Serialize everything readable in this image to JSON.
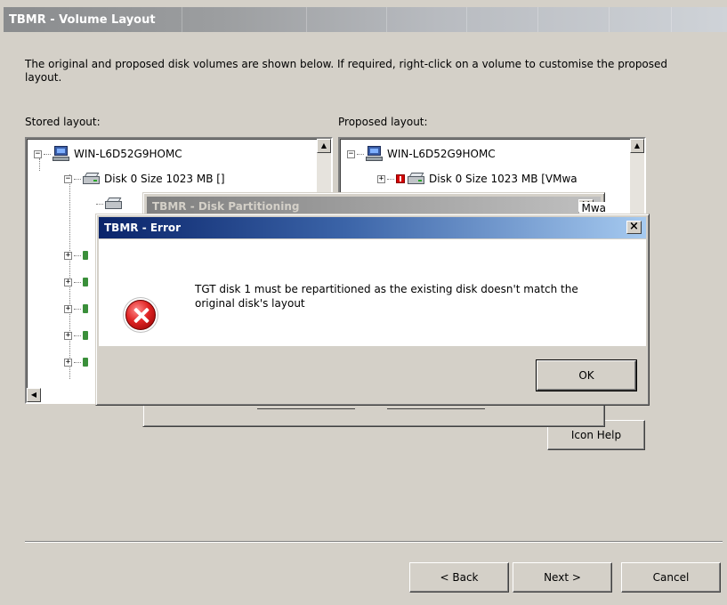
{
  "window": {
    "title": "TBMR - Volume Layout"
  },
  "intro": "The original and proposed disk volumes are shown below. If required, right-click on a volume to customise the proposed layout.",
  "stored": {
    "label": "Stored layout:",
    "root": "WIN-L6D52G9HOMC",
    "disk": "Disk 0 Size  1023 MB []"
  },
  "proposed": {
    "label": "Proposed layout:",
    "root": "WIN-L6D52G9HOMC",
    "disk": "Disk 0 Size  1023 MB [VMwa"
  },
  "icon_help_button": "Icon Help",
  "nav": {
    "back": "< Back",
    "next": "Next >",
    "cancel": "Cancel"
  },
  "partition_dialog": {
    "title": "TBMR - Disk Partitioning",
    "peek_text": "Mwa"
  },
  "error_dialog": {
    "title": "TBMR - Error",
    "message": "TGT disk 1 must be repartitioned as the existing disk doesn't match the original disk's layout",
    "ok": "OK",
    "icon": "error-icon"
  },
  "icons": {
    "computer": "computer-icon",
    "disk": "disk-icon",
    "warning": "red-warning-icon",
    "close": "close-icon"
  },
  "colors": {
    "face": "#d4d0c8",
    "active_title": "#0a246a",
    "error_red": "#e02424"
  }
}
